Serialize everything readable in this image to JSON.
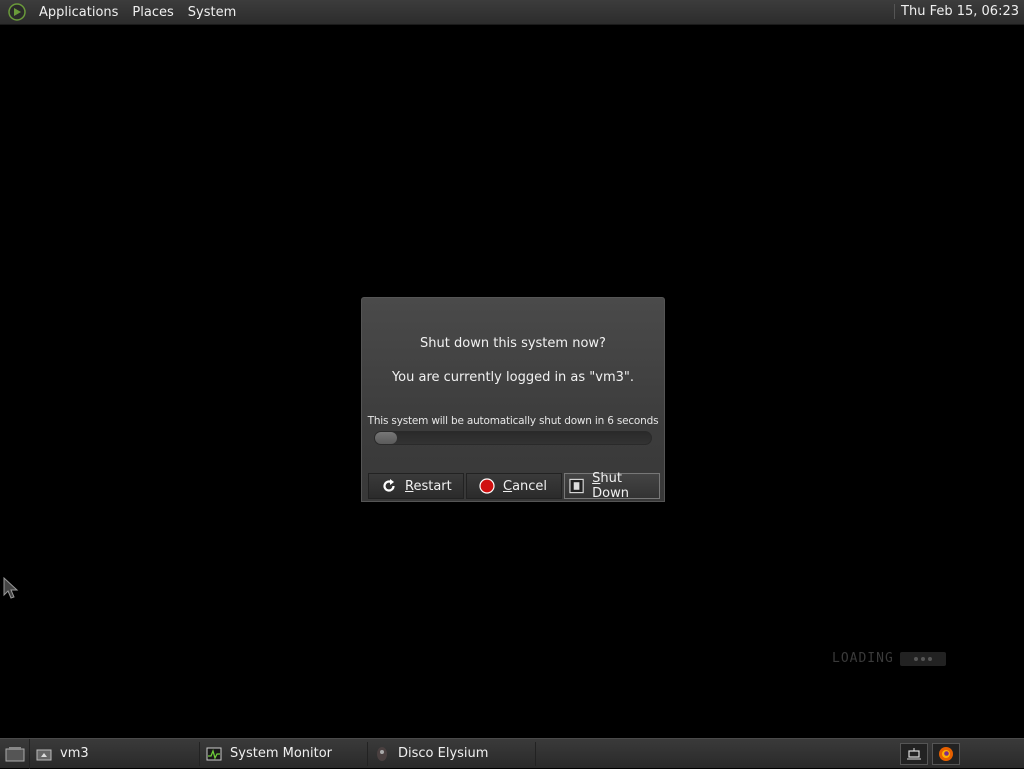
{
  "top_panel": {
    "menus": [
      "Applications",
      "Places",
      "System"
    ],
    "clock": "Thu Feb 15, 06:23"
  },
  "dialog": {
    "title": "Shut down this system now?",
    "subtitle": "You are currently logged in as \"vm3\".",
    "countdown": "This system will be automatically shut down in 6 seconds",
    "progress": 0.08,
    "buttons": {
      "restart": {
        "mnemonic": "R",
        "rest": "estart"
      },
      "cancel": {
        "mnemonic": "C",
        "rest": "ancel"
      },
      "shutdown": {
        "mnemonic": "S",
        "rest": "hut Down"
      }
    }
  },
  "desktop": {
    "loading_text": "LOADING"
  },
  "taskbar": {
    "tasks": [
      "vm3",
      "System Monitor",
      "Disco Elysium"
    ]
  },
  "colors": {
    "accent": "#6a9a3a",
    "cancel_red": "#d01010"
  }
}
